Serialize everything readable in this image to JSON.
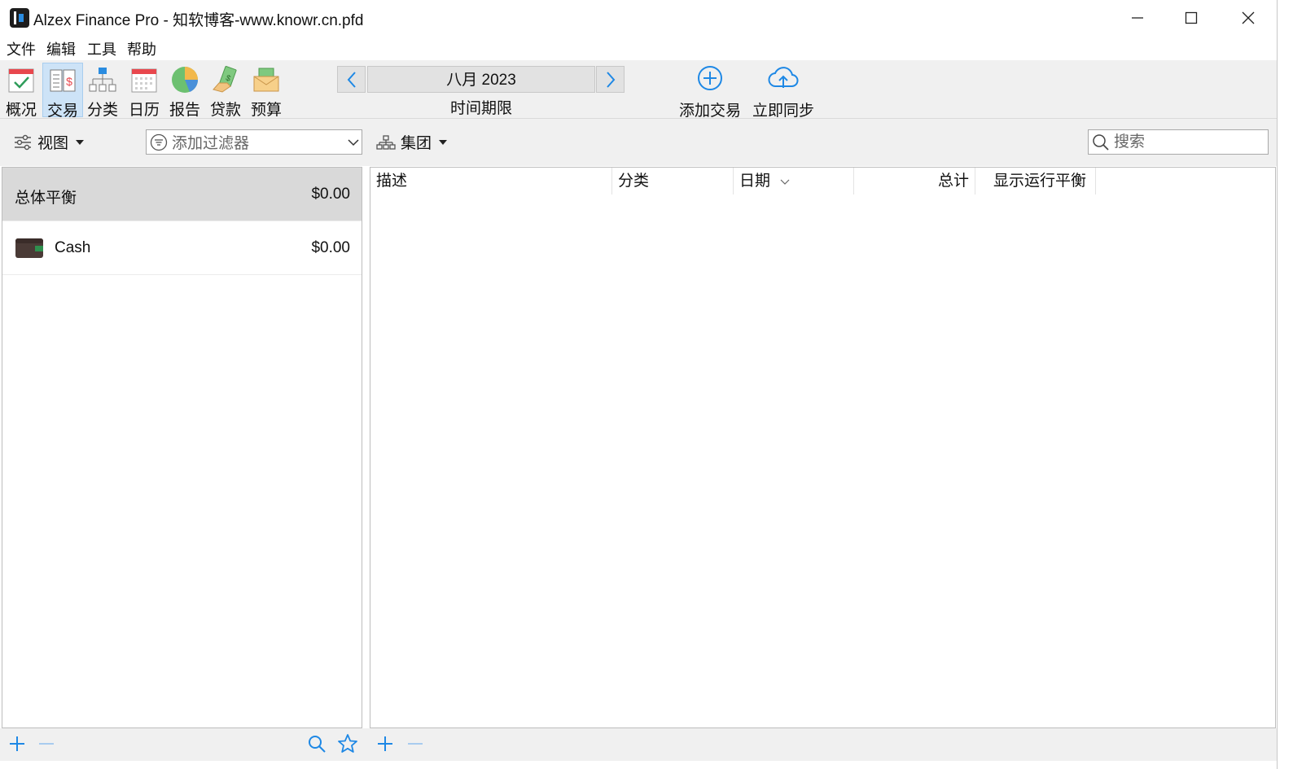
{
  "window": {
    "title": "Alzex Finance Pro - 知软博客-www.knowr.cn.pfd"
  },
  "menu": {
    "items": [
      "文件",
      "编辑",
      "工具",
      "帮助"
    ]
  },
  "toolbar": {
    "nav": [
      {
        "label": "概况",
        "icon": "overview-check-icon"
      },
      {
        "label": "交易",
        "icon": "transactions-ledger-icon",
        "active": true
      },
      {
        "label": "分类",
        "icon": "categories-tree-icon"
      },
      {
        "label": "日历",
        "icon": "calendar-icon"
      },
      {
        "label": "报告",
        "icon": "reports-pie-icon"
      },
      {
        "label": "贷款",
        "icon": "loans-hand-money-icon"
      },
      {
        "label": "预算",
        "icon": "budget-envelope-icon"
      }
    ],
    "period": {
      "value": "八月 2023",
      "caption": "时间期限"
    },
    "add_transaction": "添加交易",
    "sync_now": "立即同步"
  },
  "filterbar": {
    "view_label": "视图",
    "filter_placeholder": "添加过滤器",
    "group_label": "集团",
    "search_placeholder": "搜索"
  },
  "accounts": {
    "total": {
      "name": "总体平衡",
      "amount": "$0.00"
    },
    "items": [
      {
        "name": "Cash",
        "amount": "$0.00",
        "icon": "wallet-icon"
      }
    ]
  },
  "transactions": {
    "columns": {
      "description": "描述",
      "category": "分类",
      "date": "日期",
      "total": "总计",
      "running_balance": "显示运行平衡"
    }
  },
  "colors": {
    "accent": "#1e88e5",
    "selection": "#d9d9d9",
    "toolbar_bg": "#f0f0f0"
  }
}
